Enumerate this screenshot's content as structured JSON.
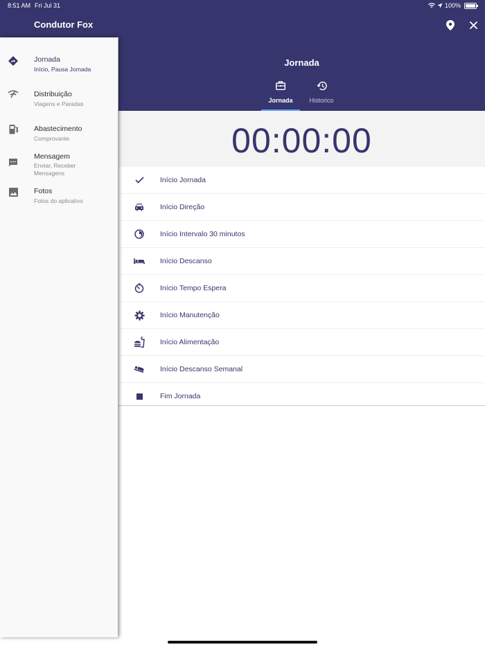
{
  "status_bar": {
    "time": "8:51 AM",
    "date": "Fri Jul 31",
    "battery": "100%"
  },
  "header": {
    "title": "Condutor Fox",
    "location_icon": "location-pin-icon",
    "close_icon": "close-icon"
  },
  "sidebar": {
    "items": [
      {
        "label": "Jornada",
        "sub": "Início, Pausa Jornada",
        "icon": "directions-icon",
        "active": true
      },
      {
        "label": "Distribuição",
        "sub": "Viagens e Paradas",
        "icon": "signal-icon"
      },
      {
        "label": "Abastecimento",
        "sub": "Comprovante",
        "icon": "gas-station-icon"
      },
      {
        "label": "Mensagem",
        "sub": "Enviar, Receber Mensagens",
        "icon": "message-icon"
      },
      {
        "label": "Fotos",
        "sub": "Fotos do aplicativo",
        "icon": "image-icon"
      }
    ]
  },
  "main": {
    "title": "Jornada",
    "tabs": [
      {
        "label": "Jornada",
        "icon": "briefcase-icon",
        "active": true
      },
      {
        "label": "Historico",
        "icon": "history-icon"
      }
    ],
    "timer": "00:00:00",
    "actions": [
      {
        "label": "Início Jornada",
        "icon": "check-icon"
      },
      {
        "label": "Início Direção",
        "icon": "car-icon"
      },
      {
        "label": "Início Intervalo 30 minutos",
        "icon": "half-timer-icon"
      },
      {
        "label": "Início Descanso",
        "icon": "bed-icon"
      },
      {
        "label": "Início Tempo Espera",
        "icon": "timer-icon"
      },
      {
        "label": "Início Manutenção",
        "icon": "gear-icon"
      },
      {
        "label": "Início Alimentação",
        "icon": "fastfood-icon"
      },
      {
        "label": "Início Descanso Semanal",
        "icon": "hotel-icon"
      },
      {
        "label": "Fim Jornada",
        "icon": "stop-icon"
      }
    ]
  },
  "colors": {
    "primary": "#36356d",
    "tab_indicator": "#5c9ff3",
    "sidebar_bg": "#f9f9f9"
  }
}
